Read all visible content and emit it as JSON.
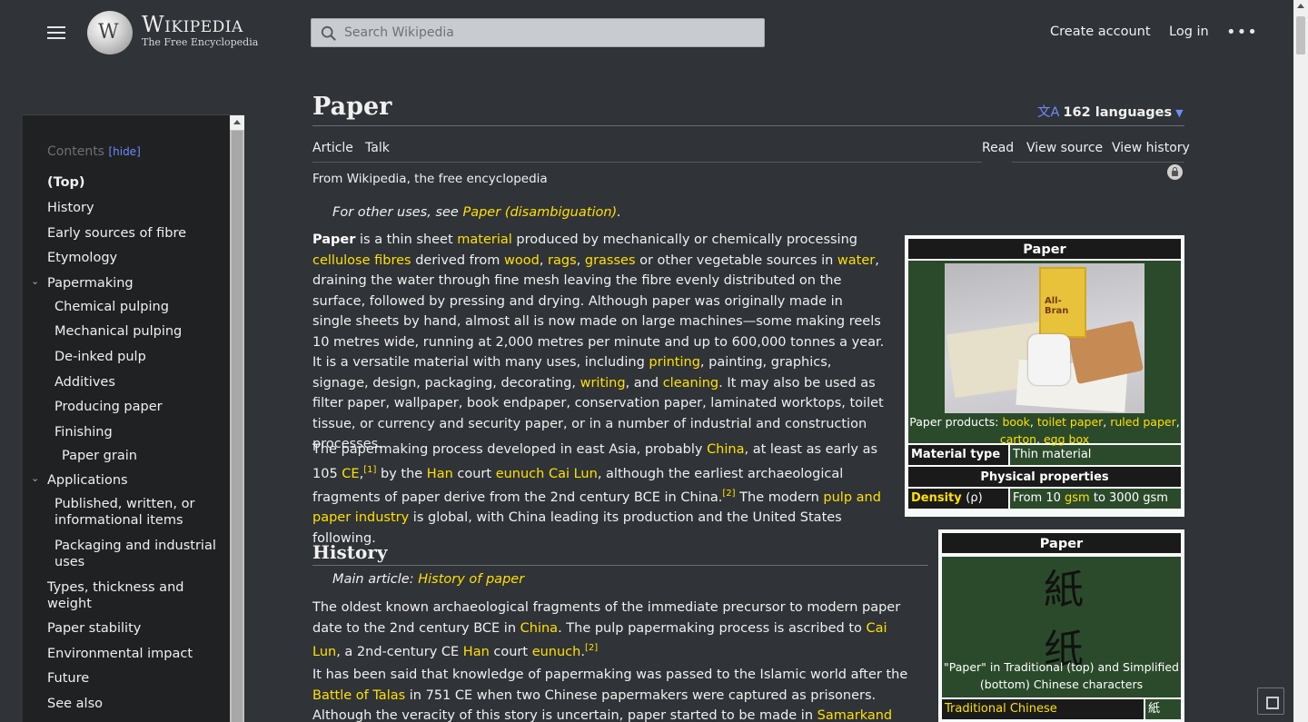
{
  "header": {
    "wordmark": "Wikipedia",
    "tagline": "The Free Encyclopedia",
    "search_placeholder": "Search Wikipedia",
    "create_account": "Create account",
    "log_in": "Log in",
    "more": "•••"
  },
  "toc": {
    "title": "Contents",
    "hide": "hide",
    "items": [
      {
        "label": "(Top)"
      },
      {
        "label": "History"
      },
      {
        "label": "Early sources of fibre"
      },
      {
        "label": "Etymology"
      },
      {
        "label": "Papermaking"
      },
      {
        "label": "Chemical pulping"
      },
      {
        "label": "Mechanical pulping"
      },
      {
        "label": "De-inked pulp"
      },
      {
        "label": "Additives"
      },
      {
        "label": "Producing paper"
      },
      {
        "label": "Finishing"
      },
      {
        "label": "Paper grain"
      },
      {
        "label": "Applications"
      },
      {
        "label": "Published, written, or informational items"
      },
      {
        "label": "Packaging and industrial uses"
      },
      {
        "label": "Types, thickness and weight"
      },
      {
        "label": "Paper stability"
      },
      {
        "label": "Environmental impact"
      },
      {
        "label": "Future"
      },
      {
        "label": "See also"
      }
    ]
  },
  "article": {
    "title": "Paper",
    "languages": "162 languages",
    "tabs": {
      "article": "Article",
      "talk": "Talk",
      "read": "Read",
      "view_source": "View source",
      "view_history": "View history"
    },
    "from": "From Wikipedia, the free encyclopedia",
    "hatnote_prefix": "For other uses, see ",
    "hatnote_link": "Paper (disambiguation)",
    "hatnote_suffix": ".",
    "history_heading": "History",
    "main_article_prefix": "Main article: ",
    "main_article_link": "History of paper"
  },
  "infobox1": {
    "title": "Paper",
    "caption_prefix": "Paper products: ",
    "caption_links": [
      "book",
      "toilet paper",
      "ruled paper",
      "carton",
      "egg box"
    ],
    "material_type_label": "Material type",
    "material_type_value": "Thin material",
    "physical_properties": "Physical properties",
    "density_label": "Density",
    "density_symbol": "(ρ)",
    "density_from": "From 10 ",
    "density_unit": "gsm",
    "density_to": " to 3000 gsm"
  },
  "infobox2": {
    "title": "Paper",
    "traditional_char": "紙",
    "simplified_char": "纸",
    "caption": "\"Paper\" in Traditional (top) and Simplified (bottom) Chinese characters",
    "row_label": "Traditional Chinese",
    "row_value": "紙"
  },
  "colors": {
    "background": "#303337",
    "link": "#ffe000",
    "infobox_green": "#2b4a2b",
    "accent_blue": "#6b8cff"
  }
}
